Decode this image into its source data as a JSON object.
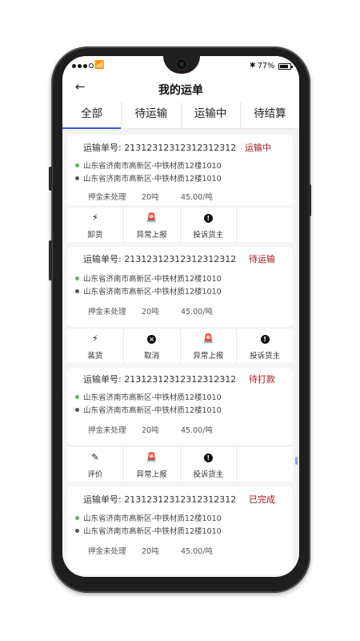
{
  "status_bar": {
    "battery": "77%"
  },
  "header": {
    "title": "我的运单",
    "back_icon": "arrow-left-icon"
  },
  "tabs": [
    {
      "label": "全部",
      "active": true
    },
    {
      "label": "待运输",
      "active": false
    },
    {
      "label": "运输中",
      "active": false
    },
    {
      "label": "待结算",
      "active": false
    }
  ],
  "colors": {
    "accent": "#3b57d6",
    "status": "#a01a1a",
    "origin_dot": "#4cc24c",
    "dest_dot": "#555555"
  },
  "orders": [
    {
      "order_label": "运输单号:",
      "order_no": "21312312312312312312",
      "status": "运输中",
      "origin": "山东省济南市高新区-中铁材质12楼1010",
      "destination": "山东省济南市高新区-中铁材质12楼1010",
      "deposit": "押金未处理",
      "weight": "20吨",
      "price": "45.00/吨",
      "actions": [
        {
          "label": "卸货",
          "icon": "lightning-icon"
        },
        {
          "label": "异常上报",
          "icon": "alarm-icon"
        },
        {
          "label": "投诉货主",
          "icon": "alert-circle-icon"
        }
      ]
    },
    {
      "order_label": "运输单号:",
      "order_no": "21312312312312312312",
      "status": "待运输",
      "origin": "山东省济南市高新区-中铁材质12楼1010",
      "destination": "山东省济南市高新区-中铁材质12楼1010",
      "deposit": "押金未处理",
      "weight": "20吨",
      "price": "45.00/吨",
      "actions": [
        {
          "label": "装货",
          "icon": "lightning-icon"
        },
        {
          "label": "取消",
          "icon": "cancel-circle-icon"
        },
        {
          "label": "异常上报",
          "icon": "alarm-icon"
        },
        {
          "label": "投诉货主",
          "icon": "alert-circle-icon"
        }
      ]
    },
    {
      "order_label": "运输单号:",
      "order_no": "21312312312312312312",
      "status": "待打款",
      "origin": "山东省济南市高新区-中铁材质12楼1010",
      "destination": "山东省济南市高新区-中铁材质12楼1010",
      "deposit": "押金未处理",
      "weight": "20吨",
      "price": "45.00/吨",
      "actions": [
        {
          "label": "评价",
          "icon": "pen-icon"
        },
        {
          "label": "异常上报",
          "icon": "alarm-icon"
        },
        {
          "label": "投诉货主",
          "icon": "alert-circle-icon"
        }
      ]
    },
    {
      "order_label": "运输单号:",
      "order_no": "21312312312312312312",
      "status": "已完成",
      "origin": "山东省济南市高新区-中铁材质12楼1010",
      "destination": "山东省济南市高新区-中铁材质12楼1010",
      "deposit": "押金未处理",
      "weight": "20吨",
      "price": "45.00/吨",
      "actions": []
    }
  ]
}
